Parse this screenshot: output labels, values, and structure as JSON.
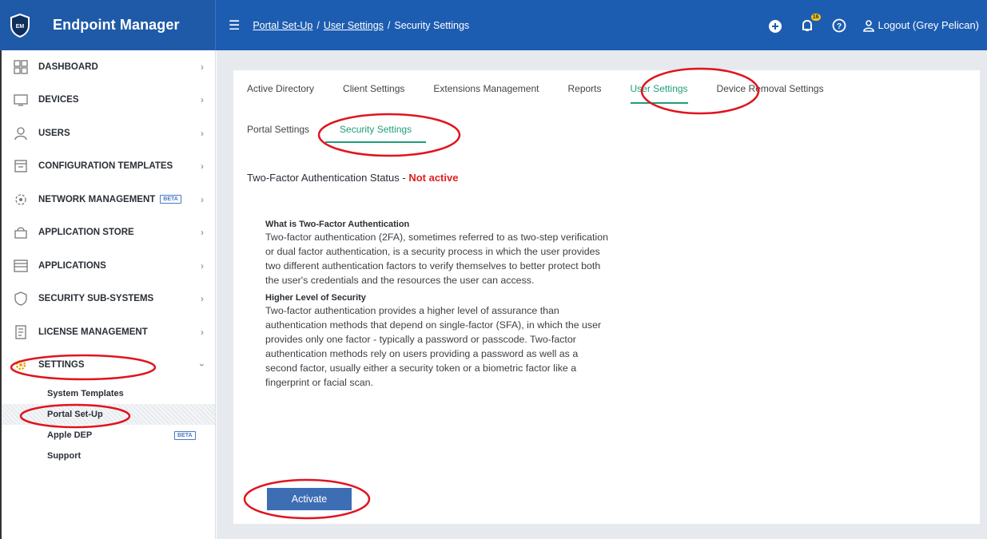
{
  "app": {
    "title": "Endpoint Manager",
    "logo_text": "EM"
  },
  "breadcrumb": {
    "items": [
      "Portal Set-Up",
      "User Settings"
    ],
    "current": "Security Settings",
    "separator": "/"
  },
  "topbar": {
    "notification_count": "16",
    "logout_label": "Logout (Grey Pelican)"
  },
  "sidebar": {
    "items": [
      {
        "label": "DASHBOARD",
        "icon": "dashboard-icon"
      },
      {
        "label": "DEVICES",
        "icon": "devices-icon"
      },
      {
        "label": "USERS",
        "icon": "user-icon"
      },
      {
        "label": "CONFIGURATION TEMPLATES",
        "icon": "config-templates-icon"
      },
      {
        "label": "NETWORK MANAGEMENT",
        "icon": "network-icon",
        "badge": "BETA"
      },
      {
        "label": "APPLICATION STORE",
        "icon": "store-icon"
      },
      {
        "label": "APPLICATIONS",
        "icon": "applications-icon"
      },
      {
        "label": "SECURITY SUB-SYSTEMS",
        "icon": "shield-icon"
      },
      {
        "label": "LICENSE MANAGEMENT",
        "icon": "license-icon"
      },
      {
        "label": "SETTINGS",
        "icon": "gear-icon"
      }
    ],
    "settings_sub": [
      {
        "label": "System Templates"
      },
      {
        "label": "Portal Set-Up"
      },
      {
        "label": "Apple DEP",
        "badge": "BETA"
      },
      {
        "label": "Support"
      }
    ]
  },
  "tabs": [
    "Active Directory",
    "Client Settings",
    "Extensions Management",
    "Reports",
    "User Settings",
    "Device Removal Settings"
  ],
  "subtabs": [
    "Portal Settings",
    "Security Settings"
  ],
  "status": {
    "label": "Two-Factor Authentication Status - ",
    "value": "Not active"
  },
  "info": {
    "heading1": "What is Two-Factor Authentication",
    "body1": "Two-factor authentication (2FA), sometimes referred to as two-step verification or dual factor authentication, is a security process in which the user provides two different authentication factors to verify themselves to better protect both the user's credentials and the resources the user can access.",
    "heading2": "Higher Level of Security",
    "body2": "Two-factor authentication provides a higher level of assurance than authentication methods that depend on single-factor (SFA), in which the user provides only one factor - typically a password or passcode. Two-factor authentication methods rely on users providing a password as well as a second factor, usually either a security token or a biometric factor like a fingerprint or facial scan."
  },
  "activate_label": "Activate",
  "colors": {
    "topbar": "#1d5db1",
    "accent": "#1f9d7a",
    "danger": "#e02020",
    "button": "#3d6eb4",
    "callout": "#e0141e"
  }
}
